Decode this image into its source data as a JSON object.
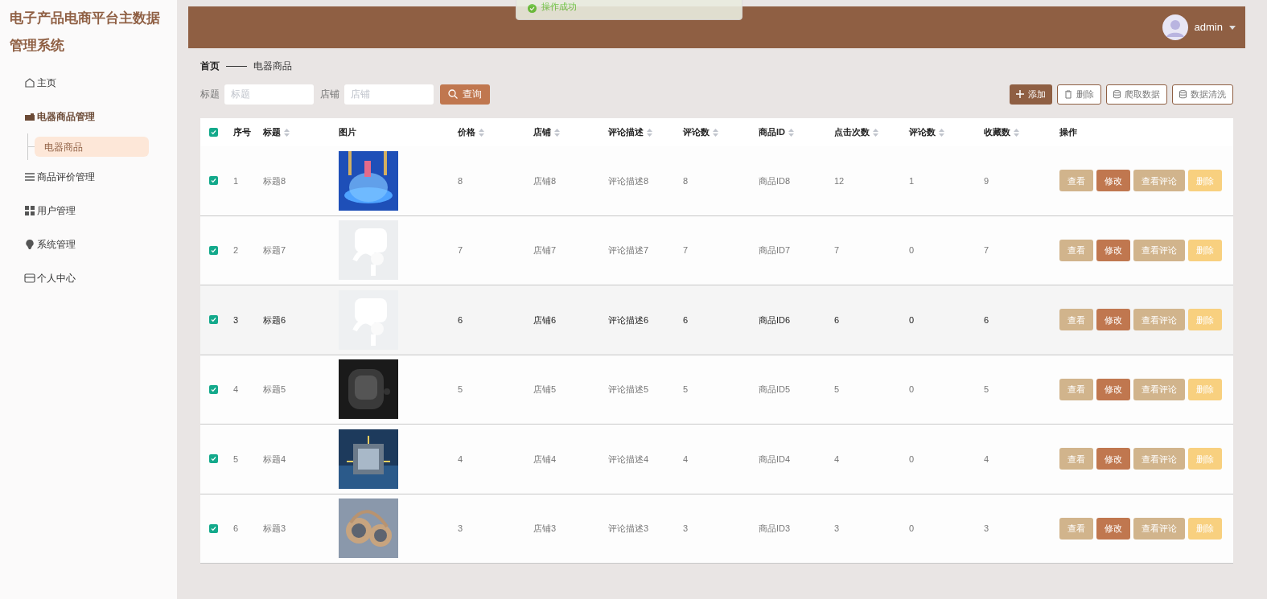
{
  "app_title": "电子产品电商平台主数据管理系统",
  "sidebar": {
    "items": [
      {
        "label": "主页",
        "expanded": false
      },
      {
        "label": "电器商品管理",
        "expanded": true,
        "children": [
          {
            "label": "电器商品",
            "selected": true
          }
        ]
      },
      {
        "label": "商品评价管理",
        "expanded": false
      },
      {
        "label": "用户管理",
        "expanded": false
      },
      {
        "label": "系统管理",
        "expanded": false
      },
      {
        "label": "个人中心",
        "expanded": false
      }
    ]
  },
  "toast": {
    "text": "操作成功"
  },
  "header": {
    "user": "admin"
  },
  "breadcrumb": [
    "首页",
    "电器商品"
  ],
  "search": {
    "fields": [
      {
        "label": "标题",
        "placeholder": "标题"
      },
      {
        "label": "店铺",
        "placeholder": "店铺"
      }
    ],
    "button": "查询"
  },
  "actions": [
    {
      "label": "添加",
      "kind": "primary"
    },
    {
      "label": "删除",
      "kind": "delete"
    },
    {
      "label": "爬取数据",
      "kind": "db"
    },
    {
      "label": "数据清洗",
      "kind": "db"
    }
  ],
  "table": {
    "all_checked": true,
    "columns": [
      {
        "label": "序号",
        "sortable": false
      },
      {
        "label": "标题",
        "sortable": true
      },
      {
        "label": "图片",
        "sortable": false
      },
      {
        "label": "价格",
        "sortable": true
      },
      {
        "label": "店铺",
        "sortable": true
      },
      {
        "label": "评论描述",
        "sortable": true
      },
      {
        "label": "评论数",
        "sortable": true
      },
      {
        "label": "商品ID",
        "sortable": true
      },
      {
        "label": "点击次数",
        "sortable": true
      },
      {
        "label": "评论数",
        "sortable": true
      },
      {
        "label": "收藏数",
        "sortable": true
      },
      {
        "label": "操作",
        "sortable": false
      }
    ],
    "rows": [
      {
        "checked": true,
        "hovered": false,
        "cells": [
          "1",
          "标题8",
          {
            "kind": "picture"
          },
          "8",
          "店铺8",
          "评论描述8",
          "8",
          "商品ID8",
          "12",
          "1",
          "9",
          {
            "buttons": [
              {
                "label": "查看",
                "kind": "view"
              },
              {
                "label": "修改",
                "kind": "edit"
              },
              {
                "label": "查看评论",
                "kind": "view"
              },
              {
                "label": "删除",
                "kind": "delete"
              }
            ]
          }
        ]
      },
      {
        "checked": true,
        "hovered": false,
        "cells": [
          "2",
          "标题7",
          {
            "kind": "picture"
          },
          "7",
          "店铺7",
          "评论描述7",
          "7",
          "商品ID7",
          "7",
          "0",
          "7",
          {
            "buttons": [
              {
                "label": "查看",
                "kind": "view"
              },
              {
                "label": "修改",
                "kind": "edit"
              },
              {
                "label": "查看评论",
                "kind": "view"
              },
              {
                "label": "删除",
                "kind": "delete"
              }
            ]
          }
        ]
      },
      {
        "checked": true,
        "hovered": true,
        "cells": [
          "3",
          "标题6",
          {
            "kind": "picture"
          },
          "6",
          "店铺6",
          "评论描述6",
          "6",
          "商品ID6",
          "6",
          "0",
          "6",
          {
            "buttons": [
              {
                "label": "查看",
                "kind": "view"
              },
              {
                "label": "修改",
                "kind": "edit"
              },
              {
                "label": "查看评论",
                "kind": "view"
              },
              {
                "label": "删除",
                "kind": "delete"
              }
            ]
          }
        ]
      },
      {
        "checked": true,
        "hovered": false,
        "cells": [
          "4",
          "标题5",
          {
            "kind": "picture"
          },
          "5",
          "店铺5",
          "评论描述5",
          "5",
          "商品ID5",
          "5",
          "0",
          "5",
          {
            "buttons": [
              {
                "label": "查看",
                "kind": "view"
              },
              {
                "label": "修改",
                "kind": "edit"
              },
              {
                "label": "查看评论",
                "kind": "view"
              },
              {
                "label": "删除",
                "kind": "delete"
              }
            ]
          }
        ]
      },
      {
        "checked": true,
        "hovered": false,
        "cells": [
          "5",
          "标题4",
          {
            "kind": "picture"
          },
          "4",
          "店铺4",
          "评论描述4",
          "4",
          "商品ID4",
          "4",
          "0",
          "4",
          {
            "buttons": [
              {
                "label": "查看",
                "kind": "view"
              },
              {
                "label": "修改",
                "kind": "edit"
              },
              {
                "label": "查看评论",
                "kind": "view"
              },
              {
                "label": "删除",
                "kind": "delete"
              }
            ]
          }
        ]
      },
      {
        "checked": true,
        "hovered": false,
        "cells": [
          "6",
          "标题3",
          {
            "kind": "picture"
          },
          "3",
          "店铺3",
          "评论描述3",
          "3",
          "商品ID3",
          "3",
          "0",
          "3",
          {
            "buttons": [
              {
                "label": "查看",
                "kind": "view"
              },
              {
                "label": "修改",
                "kind": "edit"
              },
              {
                "label": "查看评论",
                "kind": "view"
              },
              {
                "label": "删除",
                "kind": "delete"
              }
            ]
          }
        ]
      }
    ]
  }
}
